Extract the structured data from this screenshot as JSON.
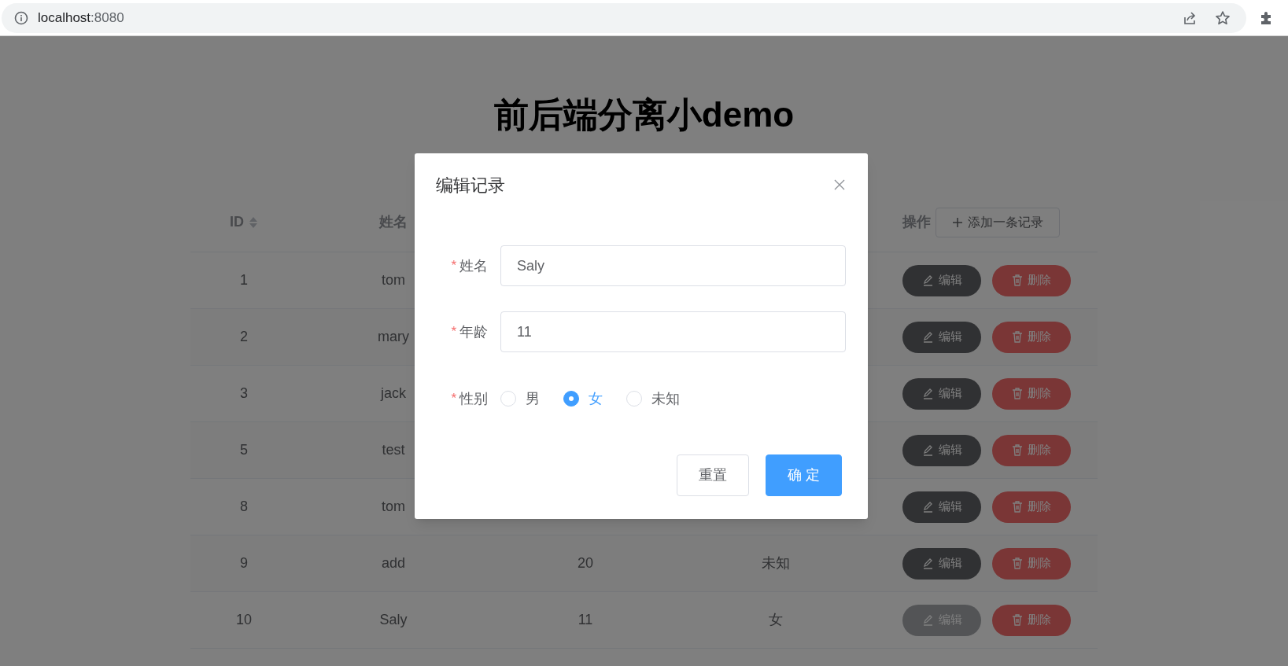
{
  "browser": {
    "url_host": "localhost",
    "url_port": ":8080"
  },
  "page": {
    "title": "前后端分离小demo"
  },
  "table": {
    "columns": [
      {
        "label": "ID",
        "sortable": true
      },
      {
        "label": "姓名",
        "sortable": false
      }
    ],
    "actions_header": "操作",
    "add_button": "添加一条记录",
    "rows": [
      {
        "id": "1",
        "name": "tom",
        "edit": "编辑",
        "delete": "删除",
        "edit_hovered": false
      },
      {
        "id": "2",
        "name": "mary",
        "edit": "编辑",
        "delete": "删除",
        "edit_hovered": false
      },
      {
        "id": "3",
        "name": "jack",
        "edit": "编辑",
        "delete": "删除",
        "edit_hovered": false
      },
      {
        "id": "5",
        "name": "test",
        "edit": "编辑",
        "delete": "删除",
        "edit_hovered": false
      },
      {
        "id": "8",
        "name": "tom",
        "edit": "编辑",
        "delete": "删除",
        "edit_hovered": false
      },
      {
        "id": "9",
        "name": "add",
        "age": "20",
        "gender": "未知",
        "edit": "编辑",
        "delete": "删除",
        "edit_hovered": false
      },
      {
        "id": "10",
        "name": "Saly",
        "age": "11",
        "gender": "女",
        "edit": "编辑",
        "delete": "删除",
        "edit_hovered": true
      }
    ]
  },
  "dialog": {
    "title": "编辑记录",
    "fields": [
      {
        "label": "姓名",
        "required_mark": "*",
        "value": "Saly"
      },
      {
        "label": "年龄",
        "required_mark": "*",
        "value": "11"
      }
    ],
    "gender": {
      "label": "性别",
      "required_mark": "*",
      "options": [
        {
          "label": "男",
          "selected": false
        },
        {
          "label": "女",
          "selected": true
        },
        {
          "label": "未知",
          "selected": false
        }
      ]
    },
    "buttons": [
      {
        "label": "重置",
        "kind": "secondary"
      },
      {
        "label": "确 定",
        "kind": "primary"
      }
    ]
  }
}
